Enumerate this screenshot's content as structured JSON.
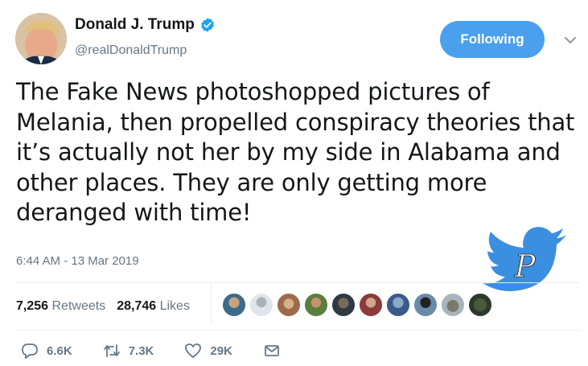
{
  "user": {
    "display_name": "Donald J. Trump",
    "handle": "@realDonaldTrump",
    "verified_icon": "verified-badge-icon"
  },
  "follow_button": {
    "label": "Following"
  },
  "tweet": {
    "text": "The Fake News photoshopped pictures of Melania, then propelled conspiracy theories that it’s actually not her by my side in Alabama and other places. They are only getting more deranged with time!",
    "timestamp": "6:44 AM - 13 Mar 2019"
  },
  "stats": {
    "retweets_count": "7,256",
    "retweets_label": "Retweets",
    "likes_count": "28,746",
    "likes_label": "Likes"
  },
  "actions": {
    "reply_count": "6.6K",
    "retweet_count": "7.3K",
    "like_count": "29K"
  },
  "watermark": {
    "letter": "P"
  },
  "colors": {
    "accent": "#1da1f2",
    "follow_bg": "#4aa0ec",
    "muted": "#657786",
    "text": "#14171a"
  }
}
